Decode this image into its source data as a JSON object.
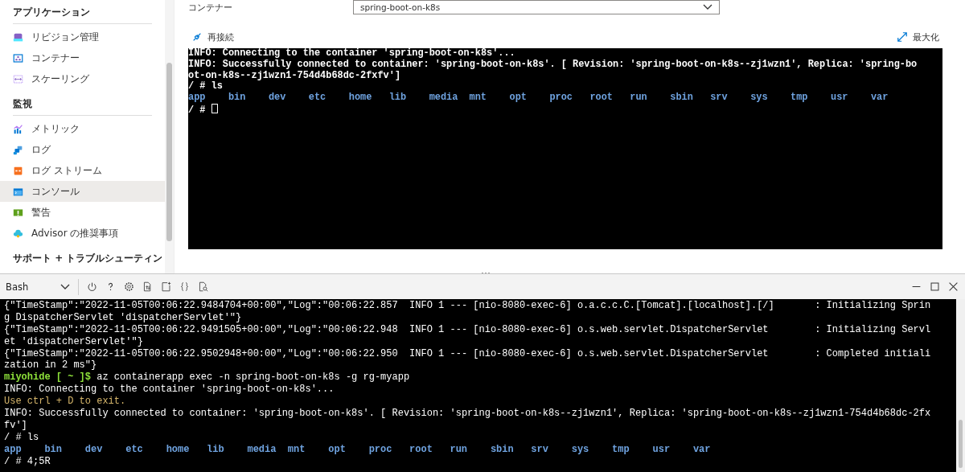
{
  "sidebar": {
    "sections": [
      {
        "title": "アプリケーション",
        "items": [
          {
            "label": "リビジョン管理",
            "selected": false
          },
          {
            "label": "コンテナー",
            "selected": false
          },
          {
            "label": "スケーリング",
            "selected": false
          }
        ]
      },
      {
        "title": "監視",
        "items": [
          {
            "label": "メトリック",
            "selected": false
          },
          {
            "label": "ログ",
            "selected": false
          },
          {
            "label": "ログ ストリーム",
            "selected": false
          },
          {
            "label": "コンソール",
            "selected": true
          },
          {
            "label": "警告",
            "selected": false
          },
          {
            "label": "Advisor の推奨事項",
            "selected": false
          }
        ]
      },
      {
        "title": "サポート + トラブルシューティン"
      }
    ]
  },
  "container_field": {
    "label": "コンテナー",
    "value": "spring-boot-on-k8s"
  },
  "reconnect_button": "再接続",
  "maximize_button": "最大化",
  "console": {
    "lines": [
      {
        "kind": "text",
        "text": "INFO: Connecting to the container 'spring-boot-on-k8s'..."
      },
      {
        "kind": "text",
        "text": "INFO: Successfully connected to container: 'spring-boot-on-k8s'. [ Revision: 'spring-boot-on-k8s--zj1wzn1', Replica: 'spring-bo"
      },
      {
        "kind": "text",
        "text": "ot-on-k8s--zj1wzn1-754d4b68dc-2fxfv']"
      },
      {
        "kind": "text",
        "text": "/ # ls"
      },
      {
        "kind": "ls",
        "entries": [
          "app",
          "bin",
          "dev",
          "etc",
          "home",
          "lib",
          "media",
          "mnt",
          "opt",
          "proc",
          "root",
          "run",
          "sbin",
          "srv",
          "sys",
          "tmp",
          "usr",
          "var"
        ]
      },
      {
        "kind": "cursor",
        "text": "/ # "
      }
    ]
  },
  "cloud_shell": {
    "shell": "Bash",
    "lines": [
      {
        "kind": "text",
        "text": "{\"TimeStamp\":\"2022-11-05T00:06:22.9484704+00:00\",\"Log\":\"00:06:22.857  INFO 1 --- [nio-8080-exec-6] o.a.c.c.C.[Tomcat].[localhost].[/]       : Initializing Sprin"
      },
      {
        "kind": "text",
        "text": "g DispatcherServlet 'dispatcherServlet'\"}"
      },
      {
        "kind": "text",
        "text": "{\"TimeStamp\":\"2022-11-05T00:06:22.9491505+00:00\",\"Log\":\"00:06:22.948  INFO 1 --- [nio-8080-exec-6] o.s.web.servlet.DispatcherServlet        : Initializing Servl"
      },
      {
        "kind": "text",
        "text": "et 'dispatcherServlet'\"}"
      },
      {
        "kind": "text",
        "text": "{\"TimeStamp\":\"2022-11-05T00:06:22.9502948+00:00\",\"Log\":\"00:06:22.950  INFO 1 --- [nio-8080-exec-6] o.s.web.servlet.DispatcherServlet        : Completed initiali"
      },
      {
        "kind": "text",
        "text": "zation in 2 ms\"}"
      },
      {
        "kind": "prompt",
        "user": "miyohide [ ~ ]$",
        "text": "az containerapp exec -n spring-boot-on-k8s -g rg-myapp"
      },
      {
        "kind": "text",
        "text": "INFO: Connecting to the container 'spring-boot-on-k8s'..."
      },
      {
        "kind": "warning",
        "text": "Use ctrl + D to exit."
      },
      {
        "kind": "text",
        "text": "INFO: Successfully connected to container: 'spring-boot-on-k8s'. [ Revision: 'spring-boot-on-k8s--zj1wzn1', Replica: 'spring-boot-on-k8s--zj1wzn1-754d4b68dc-2fx"
      },
      {
        "kind": "text",
        "text": "fv']"
      },
      {
        "kind": "text",
        "text": "/ # ls"
      },
      {
        "kind": "ls",
        "entries": [
          "app",
          "bin",
          "dev",
          "etc",
          "home",
          "lib",
          "media",
          "mnt",
          "opt",
          "proc",
          "root",
          "run",
          "sbin",
          "srv",
          "sys",
          "tmp",
          "usr",
          "var"
        ]
      },
      {
        "kind": "text",
        "text": "/ # 4;5R"
      }
    ]
  }
}
